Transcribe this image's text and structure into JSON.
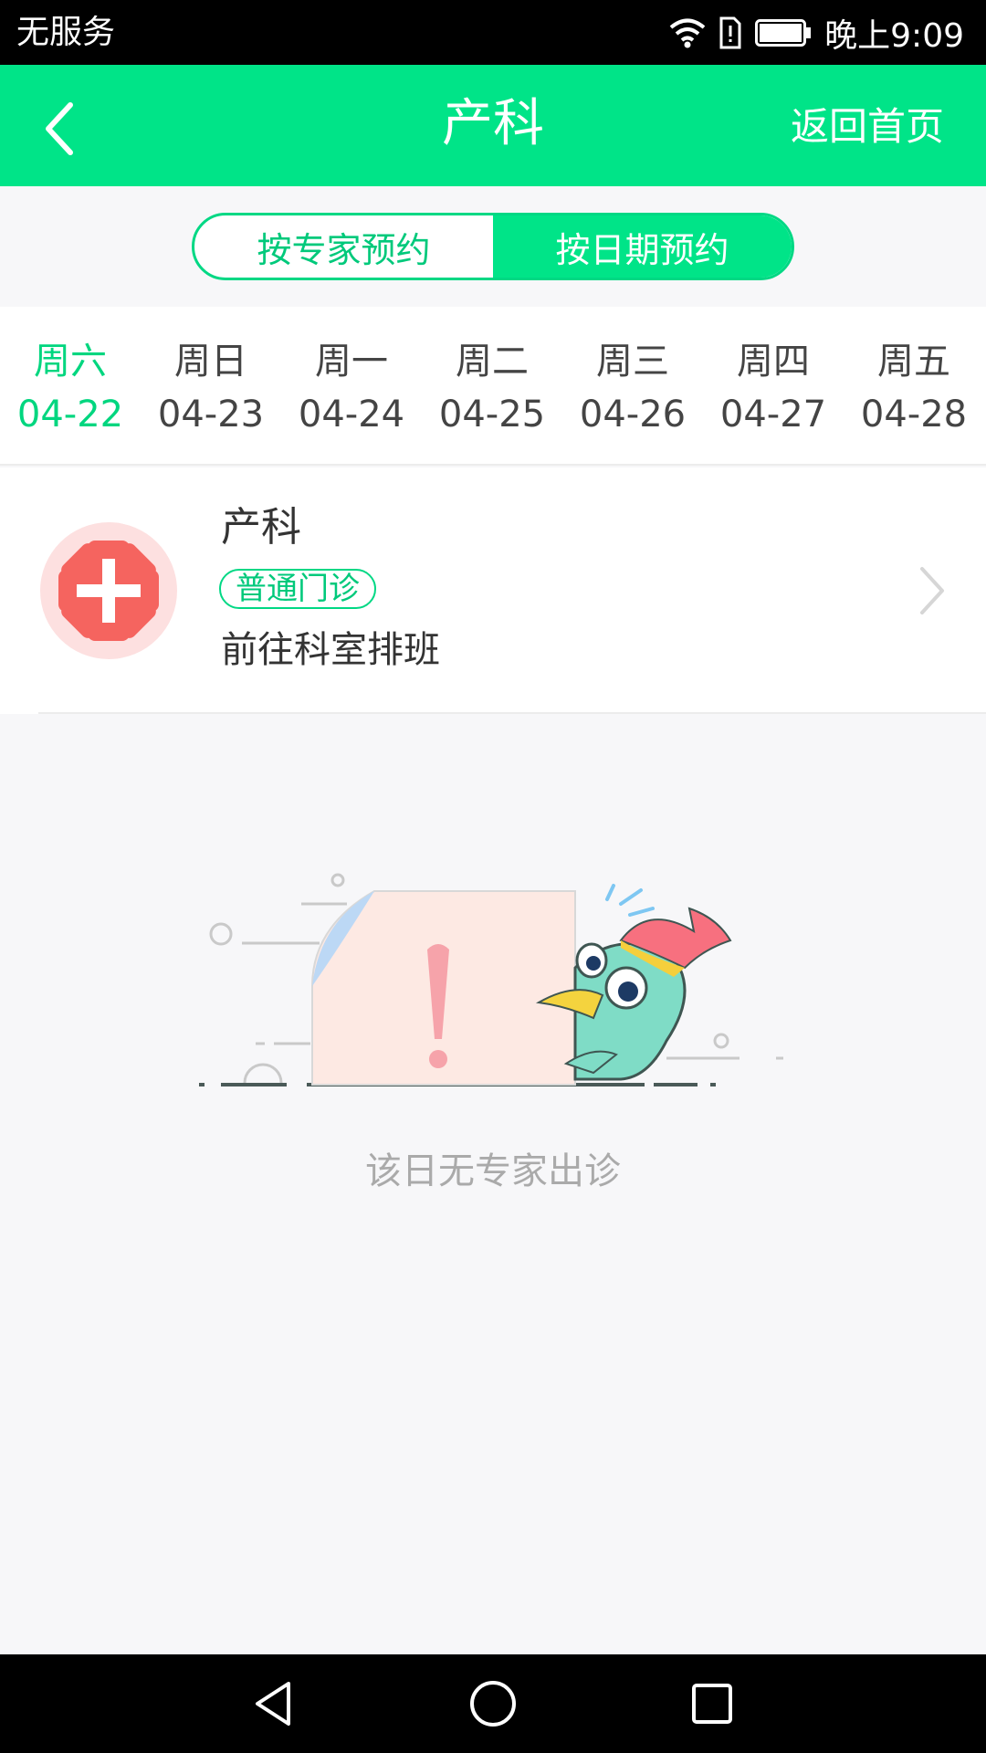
{
  "status_bar": {
    "carrier": "无服务",
    "time": "晚上9:09",
    "icons": [
      "wifi-icon",
      "sim-alert-icon",
      "battery-icon"
    ]
  },
  "header": {
    "title": "产科",
    "back_icon": "chevron-left-icon",
    "home_label": "返回首页"
  },
  "segment": {
    "tabs": [
      {
        "label": "按专家预约",
        "active": false
      },
      {
        "label": "按日期预约",
        "active": true
      }
    ]
  },
  "dates": [
    {
      "weekday": "周六",
      "date": "04-22",
      "active": true
    },
    {
      "weekday": "周日",
      "date": "04-23",
      "active": false
    },
    {
      "weekday": "周一",
      "date": "04-24",
      "active": false
    },
    {
      "weekday": "周二",
      "date": "04-25",
      "active": false
    },
    {
      "weekday": "周三",
      "date": "04-26",
      "active": false
    },
    {
      "weekday": "周四",
      "date": "04-27",
      "active": false
    },
    {
      "weekday": "周五",
      "date": "04-28",
      "active": false
    }
  ],
  "department": {
    "name": "产科",
    "tag": "普通门诊",
    "subtitle": "前往科室排班",
    "icon": "medical-cross-icon"
  },
  "empty_state": {
    "text": "该日无专家出诊",
    "illustration": "bird-with-alert-icon"
  },
  "nav_bar": {
    "icons": [
      "nav-back-icon",
      "nav-home-icon",
      "nav-recents-icon"
    ]
  },
  "colors": {
    "accent": "#00e488",
    "accent_text": "#00c97b",
    "status_bar": "#000000",
    "page_bg": "#f7f7f9"
  }
}
